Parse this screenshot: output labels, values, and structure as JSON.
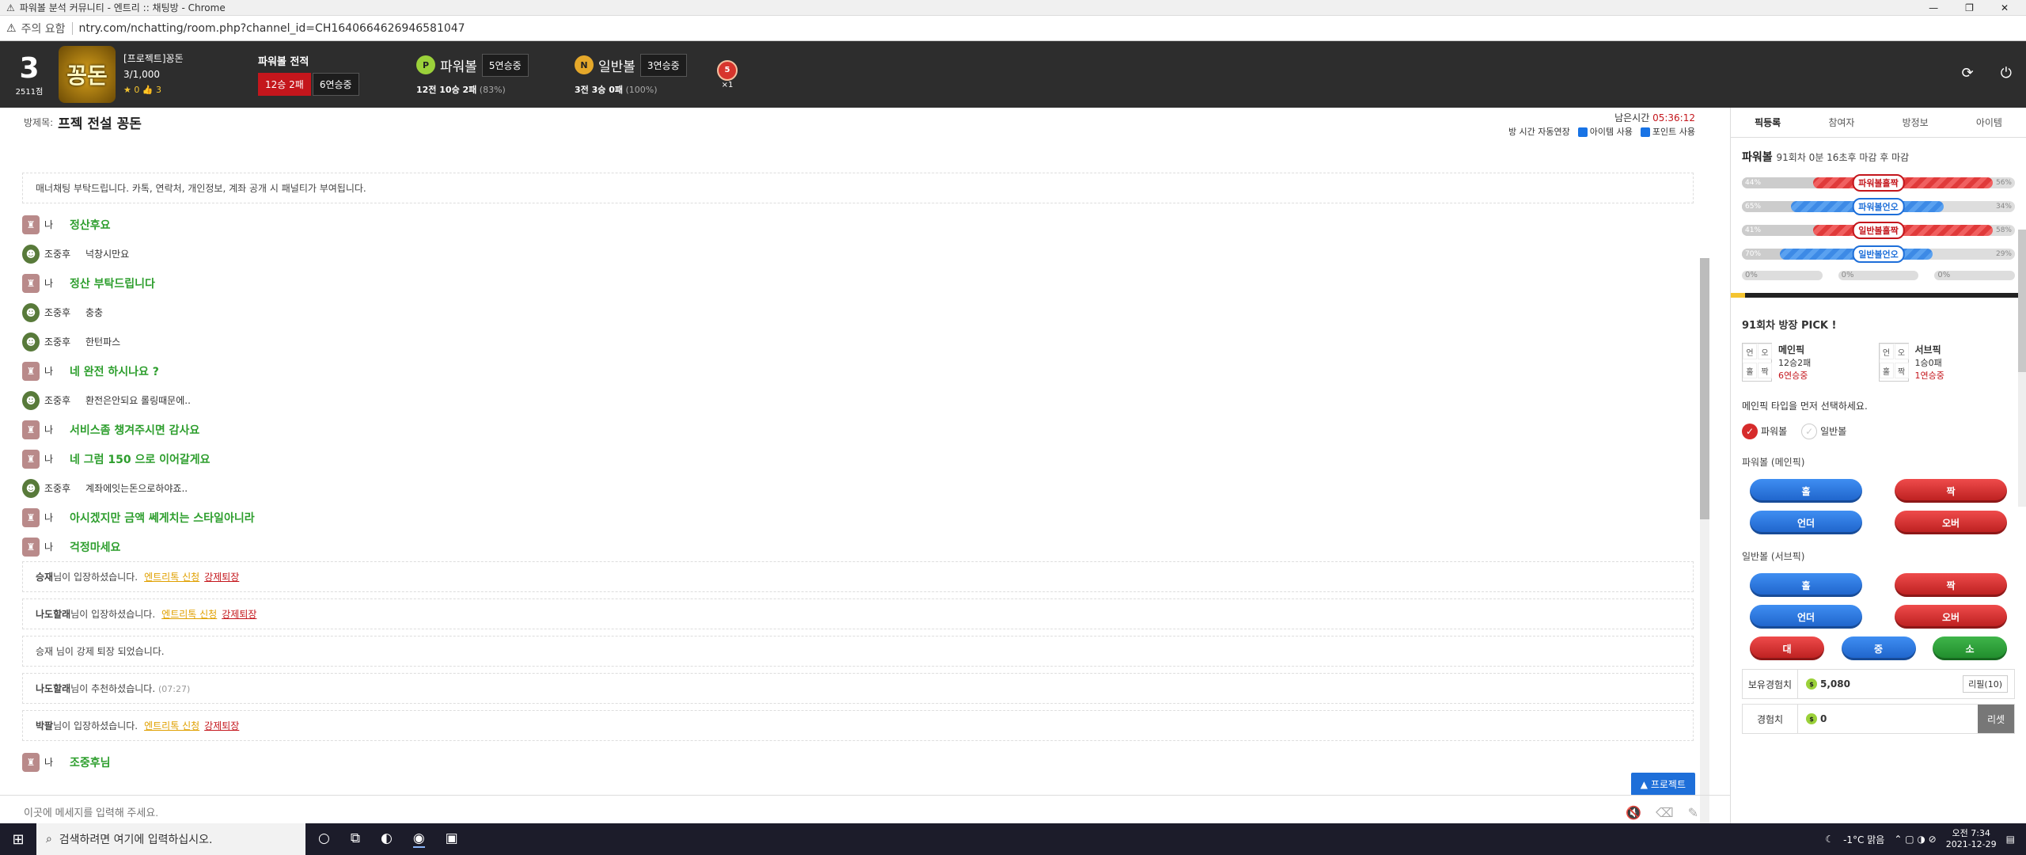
{
  "window": {
    "title": "파워볼 분석 커뮤니티 - 엔트리 :: 채팅방 - Chrome"
  },
  "address": {
    "warning": "주의 요함",
    "url": "ntry.com/nchatting/room.php?channel_id=CH1640664626946581047"
  },
  "profile": {
    "level": "3",
    "points": "2511점",
    "badge_text": "꽁돈",
    "name": "[프로젝트]꽁돈",
    "members": "3/1,000",
    "stars": "★ 0",
    "likes": "👍 3"
  },
  "record": {
    "title": "파워볼 전적",
    "winloss": "12승 2패",
    "streak": "6연승중"
  },
  "powerball": {
    "coin": "P",
    "label": "파워볼",
    "streak": "5연승중",
    "summary": "12전 10승 2패",
    "pct": "(83%)"
  },
  "normalball": {
    "coin": "N",
    "label": "일반볼",
    "streak": "3연승중",
    "summary": "3전 3승 0패",
    "pct": "(100%)"
  },
  "medal": {
    "num": "5",
    "mult": "×1"
  },
  "room": {
    "label": "방제목:",
    "title": "프젝 전설 꽁돈",
    "remain_label": "남은시간",
    "remain": "05:36:12",
    "opt_auto": "방 시간 자동연장",
    "opt_item": "아이템 사용",
    "opt_point": "포인트 사용"
  },
  "notice": "매너채팅 부탁드립니다. 카톡, 연락처, 개인정보, 계좌 공개 시 패널티가 부여됩니다.",
  "messages": [
    {
      "who": "나",
      "text": "정산후요",
      "me": true
    },
    {
      "who": "조중후",
      "text": "넉창시만요",
      "me": false
    },
    {
      "who": "나",
      "text": "정산 부탁드립니다",
      "me": true
    },
    {
      "who": "조중후",
      "text": "충충",
      "me": false
    },
    {
      "who": "조중후",
      "text": "한턴파스",
      "me": false
    },
    {
      "who": "나",
      "text": "네 완전 하시나요 ?",
      "me": true
    },
    {
      "who": "조중후",
      "text": "환전은안되요 롤링때문에..",
      "me": false
    },
    {
      "who": "나",
      "text": "서비스좀 챙겨주시면 감사요",
      "me": true
    },
    {
      "who": "나",
      "text": "네 그럼 150 으로 이어갈게요",
      "me": true
    },
    {
      "who": "조중후",
      "text": "계좌에잇는돈으로하야죠..",
      "me": false
    },
    {
      "who": "나",
      "text": "아시겠지만 금액 쎄게치는 스타일아니라",
      "me": true
    },
    {
      "who": "나",
      "text": "걱정마세요",
      "me": true
    }
  ],
  "system": [
    {
      "name": "승재",
      "text": "님이 입장하셨습니다.",
      "link1": "엔트리톡 신청",
      "link2": "강제퇴장"
    },
    {
      "name": "나도할래",
      "text": "님이 입장하셨습니다.",
      "link1": "엔트리톡 신청",
      "link2": "강제퇴장"
    },
    {
      "plain": "승재 님이 강제 퇴장 되었습니다."
    },
    {
      "name": "나도할래",
      "text": "님이 추천하셨습니다.",
      "time": "(07:27)"
    },
    {
      "name": "박팔",
      "text": "님이 입장하셨습니다.",
      "link1": "엔트리톡 신청",
      "link2": "강제퇴장"
    }
  ],
  "last_message": {
    "who": "나",
    "text": "조중후님"
  },
  "project_btn": "▲ 프로젝트",
  "input": {
    "placeholder": "이곳에 메세지를 입력해 주세요."
  },
  "tabs": [
    "픽등록",
    "참여자",
    "방정보",
    "아이템"
  ],
  "pb_round": {
    "title": "파워볼",
    "info": "91회차 0분 16초후 마감 후 마감"
  },
  "bars": [
    {
      "left": "44%",
      "label": "파워볼홀짝",
      "right": "56%",
      "color": "red",
      "fill": 0.56
    },
    {
      "left": "65%",
      "label": "파워볼언오",
      "right": "34%",
      "color": "blue",
      "fill": 0.65
    },
    {
      "left": "41%",
      "label": "일반볼홀짝",
      "right": "58%",
      "color": "red",
      "fill": 0.58
    },
    {
      "left": "70%",
      "label": "일반볼언오",
      "right": "29%",
      "color": "blue",
      "fill": 0.7
    }
  ],
  "misc": [
    "0%",
    "0%",
    "0%"
  ],
  "pick": {
    "title": "91회차 방장 PICK !",
    "main": {
      "cells": [
        "언",
        "오",
        "홀",
        "짝"
      ],
      "name": "메인픽",
      "rec": "12승2패",
      "streak": "6연승중"
    },
    "sub": {
      "cells": [
        "언",
        "오",
        "홀",
        "짝"
      ],
      "name": "서브픽",
      "rec": "1승0패",
      "streak": "1연승중"
    }
  },
  "select": {
    "title": "메인픽 타입을 먼저 선택하세요.",
    "opt1": "파워볼",
    "opt2": "일반볼"
  },
  "pb_section": "파워볼 (메인픽)",
  "nb_section": "일반볼 (서브픽)",
  "btns": {
    "odd": "홀",
    "even": "짝",
    "under": "언더",
    "over": "오버",
    "big": "대",
    "mid": "중",
    "small": "소"
  },
  "stats": {
    "exp_label": "보유경험치",
    "exp": "5,080",
    "refill": "리필(10)",
    "xp_label": "경험치",
    "xp": "0",
    "reset": "리셋"
  },
  "taskbar": {
    "search": "검색하려면 여기에 입력하십시오.",
    "weather": "-1°C 맑음",
    "time": "오전 7:34",
    "date": "2021-12-29"
  }
}
